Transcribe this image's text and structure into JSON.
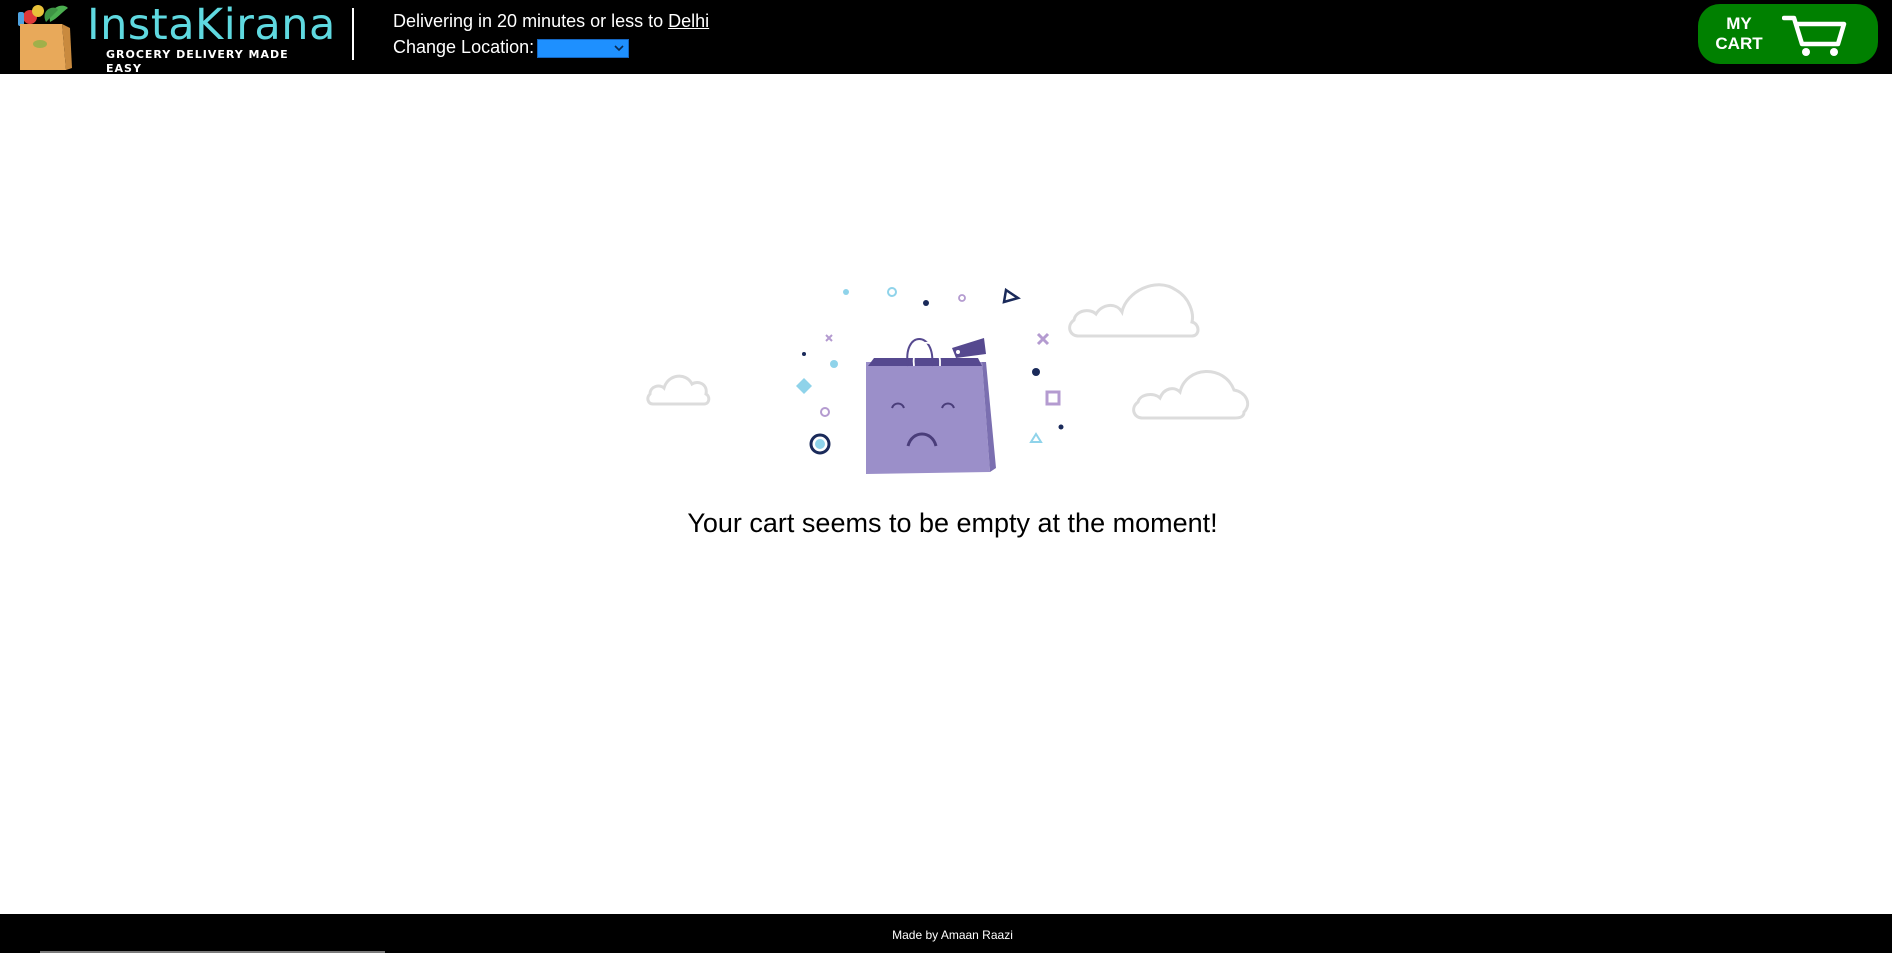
{
  "header": {
    "logo": {
      "name": "InstaKirana",
      "tagline": "GROCERY DELIVERY MADE EASY"
    },
    "delivery": {
      "prefix": "Delivering in 20 minutes or less to ",
      "city": "Delhi"
    },
    "location": {
      "label": "Change Location:",
      "selected_value": ""
    },
    "cart": {
      "label_line1": "MY",
      "label_line2": "CART",
      "icon": "shopping-cart-icon",
      "color": "#008000"
    }
  },
  "main": {
    "illustration": "sad-shopping-bag",
    "message": "Your cart seems to be empty at the moment!"
  },
  "footer": {
    "credit": "Made by Amaan Raazi"
  },
  "colors": {
    "header_bg": "#000000",
    "brand_teal": "#5fd9e0",
    "select_bg": "#1e90ff",
    "bag_purple": "#9b8fc9"
  }
}
